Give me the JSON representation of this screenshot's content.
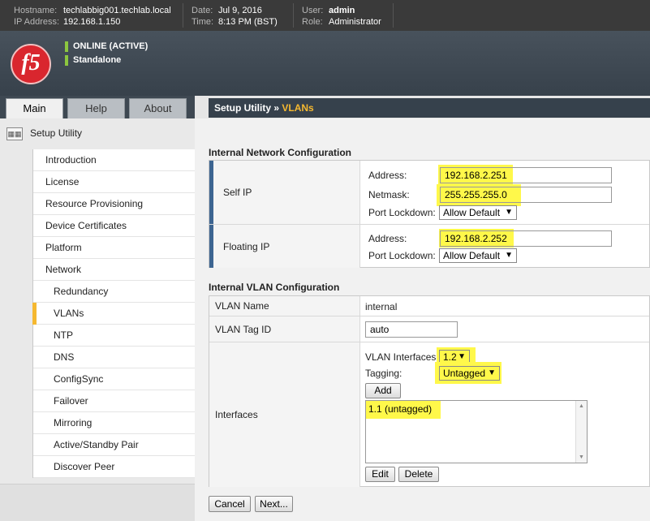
{
  "header": {
    "hostname_label": "Hostname:",
    "hostname": "techlabbig001.techlab.local",
    "ip_label": "IP Address:",
    "ip": "192.168.1.150",
    "date_label": "Date:",
    "date": "Jul 9, 2016",
    "time_label": "Time:",
    "time": "8:13 PM (BST)",
    "user_label": "User:",
    "user": "admin",
    "role_label": "Role:",
    "role": "Administrator",
    "logo_text": "f5",
    "status_1": "ONLINE (ACTIVE)",
    "status_2": "Standalone"
  },
  "tabs": {
    "main": "Main",
    "help": "Help",
    "about": "About"
  },
  "breadcrumb": {
    "root": "Setup Utility",
    "sep": "»",
    "current": "VLANs"
  },
  "sidebar": {
    "title": "Setup Utility",
    "items": [
      {
        "label": "Introduction"
      },
      {
        "label": "License"
      },
      {
        "label": "Resource Provisioning"
      },
      {
        "label": "Device Certificates"
      },
      {
        "label": "Platform"
      },
      {
        "label": "Network"
      },
      {
        "label": "Redundancy"
      },
      {
        "label": "VLANs"
      },
      {
        "label": "NTP"
      },
      {
        "label": "DNS"
      },
      {
        "label": "ConfigSync"
      },
      {
        "label": "Failover"
      },
      {
        "label": "Mirroring"
      },
      {
        "label": "Active/Standby Pair"
      },
      {
        "label": "Discover Peer"
      }
    ]
  },
  "internal_network": {
    "title": "Internal Network Configuration",
    "self_ip": {
      "label": "Self IP",
      "address_label": "Address:",
      "address": "192.168.2.251",
      "netmask_label": "Netmask:",
      "netmask": "255.255.255.0",
      "port_lockdown_label": "Port Lockdown:",
      "port_lockdown": "Allow Default"
    },
    "floating_ip": {
      "label": "Floating IP",
      "address_label": "Address:",
      "address": "192.168.2.252",
      "port_lockdown_label": "Port Lockdown:",
      "port_lockdown": "Allow Default"
    }
  },
  "internal_vlan": {
    "title": "Internal VLAN Configuration",
    "vlan_name_label": "VLAN Name",
    "vlan_name": "internal",
    "vlan_tag_label": "VLAN Tag ID",
    "vlan_tag": "auto",
    "interfaces_label": "Interfaces",
    "vlan_interfaces_label": "VLAN Interfaces",
    "vlan_interfaces": "1.2",
    "tagging_label": "Tagging:",
    "tagging": "Untagged",
    "add_button": "Add",
    "interfaces_list": [
      "1.1 (untagged)"
    ],
    "edit_button": "Edit",
    "delete_button": "Delete"
  },
  "footer": {
    "cancel": "Cancel",
    "next": "Next..."
  },
  "colors": {
    "highlight": "#fff84a",
    "accent": "#f5b830",
    "status_green": "#8cc63f"
  }
}
